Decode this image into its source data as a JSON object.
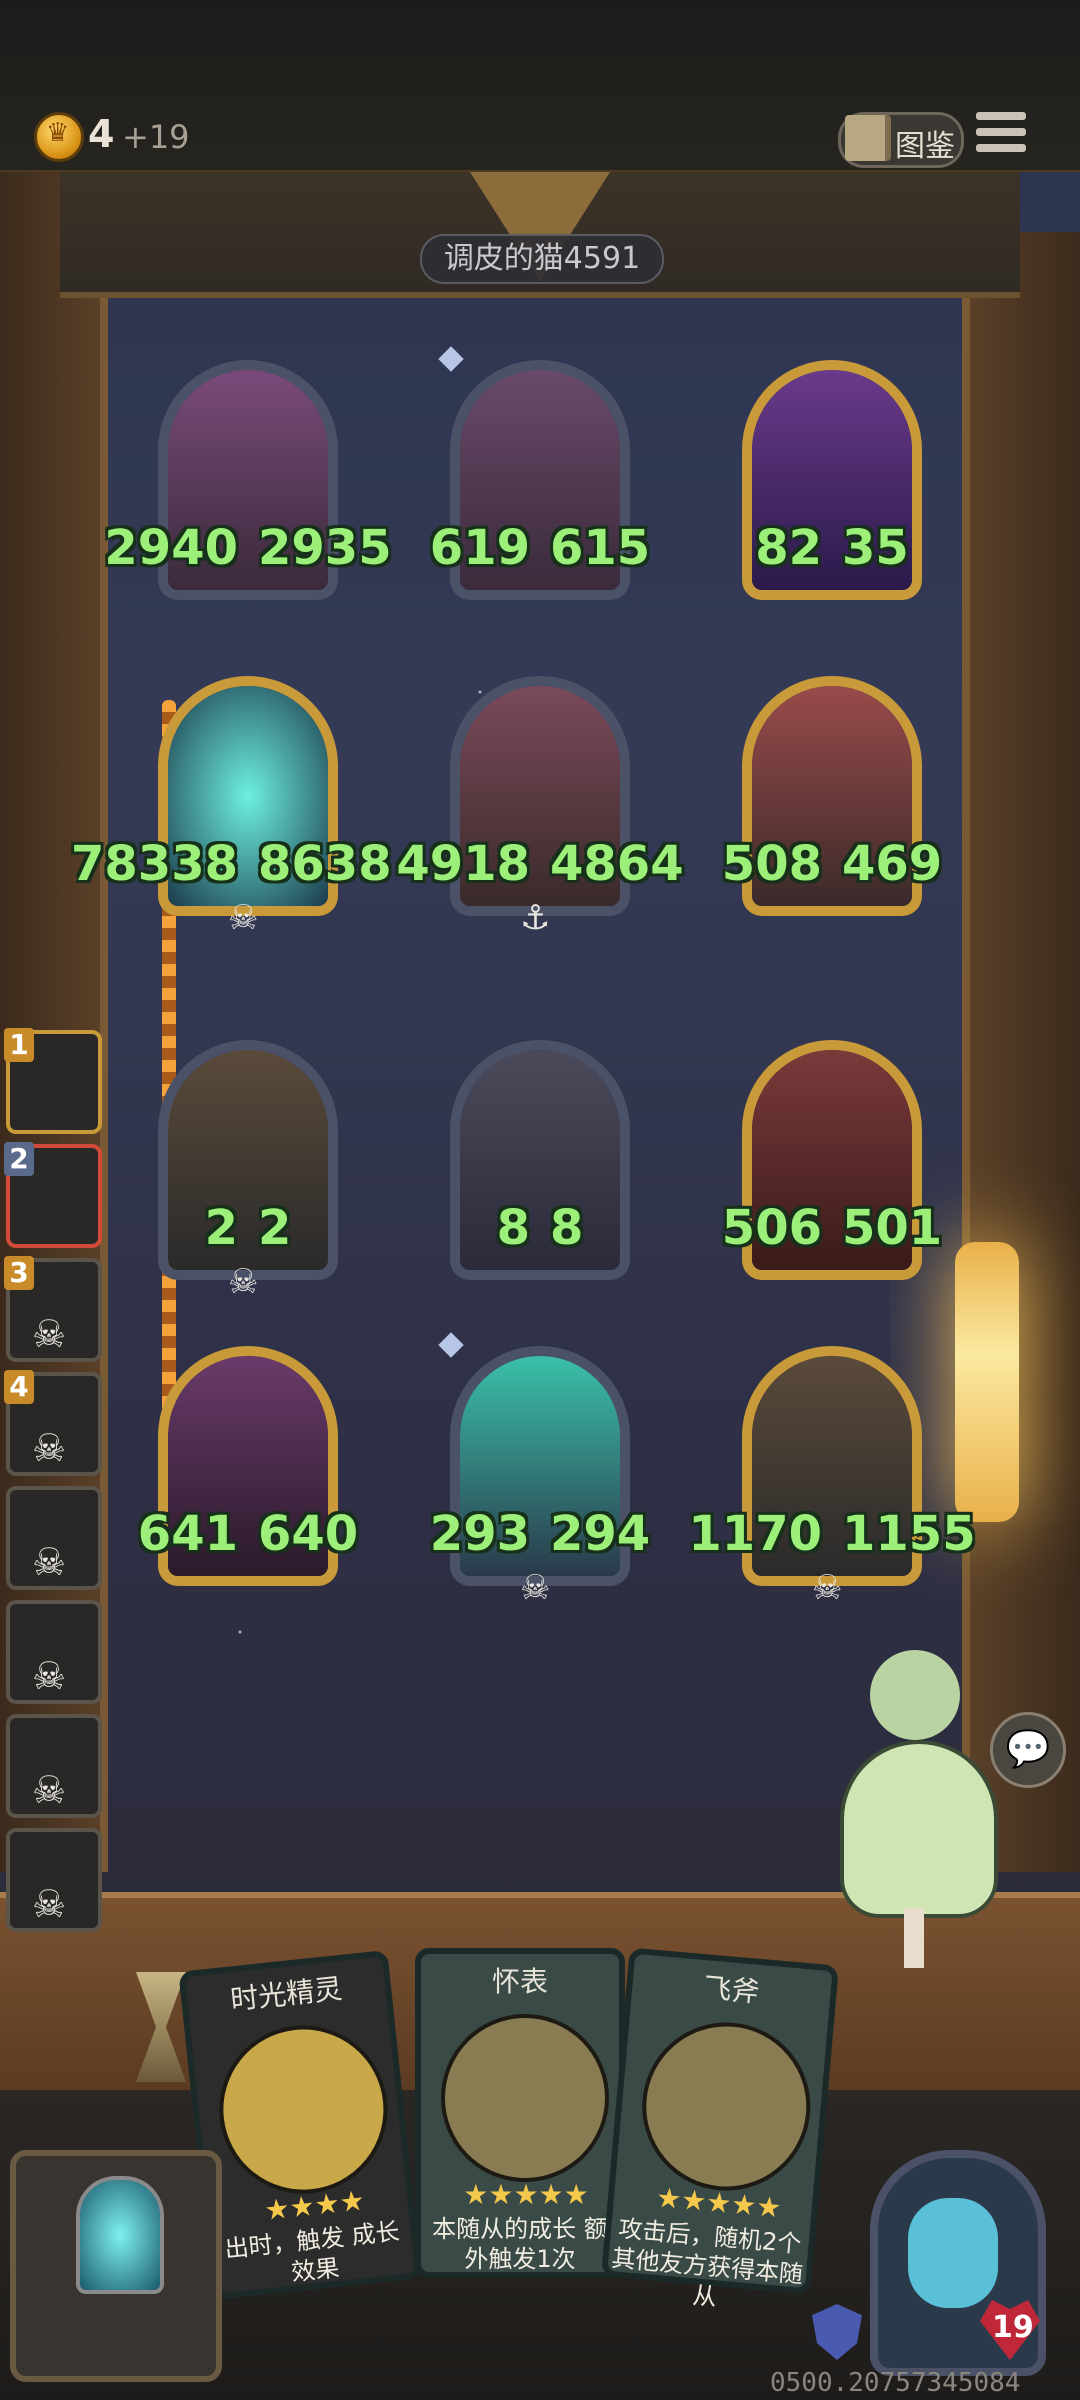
{
  "header": {
    "gold": "4",
    "gold_income": "+19",
    "codex_label": "图鉴"
  },
  "opponent_name": "调皮的猫4591",
  "units": [
    {
      "atk": "2940",
      "hp": "2935"
    },
    {
      "atk": "619",
      "hp": "615"
    },
    {
      "atk": "82",
      "hp": "35"
    },
    {
      "atk": "78338",
      "hp": "8638"
    },
    {
      "atk": "4918",
      "hp": "4864"
    },
    {
      "atk": "508",
      "hp": "469"
    },
    {
      "atk": "2",
      "hp": "2"
    },
    {
      "atk": "8",
      "hp": "8"
    },
    {
      "atk": "506",
      "hp": "501"
    },
    {
      "atk": "641",
      "hp": "640"
    },
    {
      "atk": "293",
      "hp": "294"
    },
    {
      "atk": "1170",
      "hp": "1155"
    }
  ],
  "queue": [
    "1",
    "2",
    "3",
    "4"
  ],
  "hand": [
    {
      "name": "时光精灵",
      "desc": "出时，触发 成长效果"
    },
    {
      "name": "怀表",
      "desc": "本随从的成长 额外触发1次"
    },
    {
      "name": "飞斧",
      "desc": "攻击后，随机2个 其他友方获得本随从"
    }
  ],
  "player": {
    "health": "19"
  },
  "session_id": "0500.20757345084"
}
